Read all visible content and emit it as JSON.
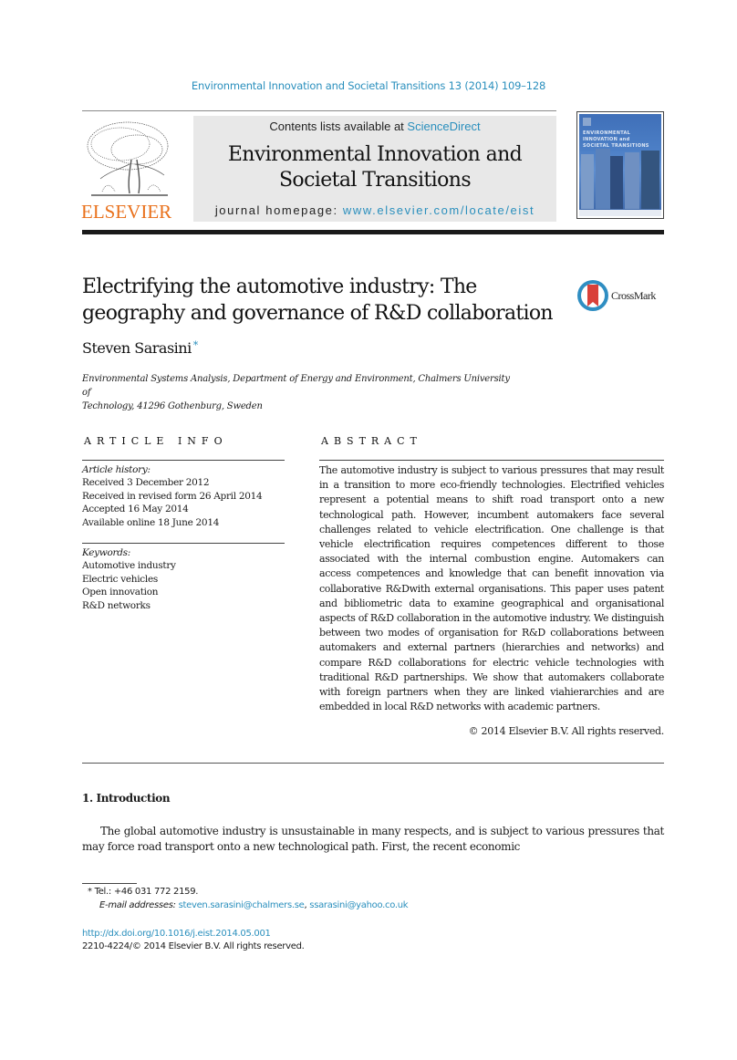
{
  "header": {
    "journal_ref": "Environmental Innovation and Societal Transitions 13 (2014) 109–128",
    "publisher_wordmark": "ELSEVIER",
    "contents_prefix": "Contents lists available at ",
    "contents_link": "ScienceDirect",
    "journal_title_line1": "Environmental Innovation and",
    "journal_title_line2": "Societal Transitions",
    "homepage_prefix": "journal homepage: ",
    "homepage_link": "www.elsevier.com/locate/eist",
    "cover": {
      "line1": "ENVIRONMENTAL",
      "line2": "INNOVATION and",
      "line3": "SOCIETAL TRANSITIONS"
    }
  },
  "article": {
    "title_line1": "Electrifying the automotive industry: The",
    "title_line2": "geography and governance of R&D collaboration",
    "crossmark_label": "CrossMark",
    "author": "Steven Sarasini",
    "author_mark": "*",
    "affiliation_line1": "Environmental Systems Analysis, Department of Energy and Environment, Chalmers University of",
    "affiliation_line2": "Technology, 41296 Gothenburg, Sweden"
  },
  "article_info": {
    "heading": "ARTICLE INFO",
    "history_label": "Article history:",
    "history": [
      "Received 3 December 2012",
      "Received in revised form 26 April 2014",
      "Accepted 16 May 2014",
      "Available online 18 June 2014"
    ],
    "keywords_label": "Keywords:",
    "keywords": [
      "Automotive industry",
      "Electric vehicles",
      "Open innovation",
      "R&D networks"
    ]
  },
  "abstract": {
    "heading": "ABSTRACT",
    "text": "The automotive industry is subject to various pressures that may result in a transition to more eco-friendly technologies. Electrified vehicles represent a potential means to shift road transport onto a new technological path. However, incumbent automakers face several challenges related to vehicle electrification. One challenge is that vehicle electrification requires competences different to those associated with the internal combustion engine. Automakers can access competences and knowledge that can benefit innovation via collaborative R&Dwith external organisations. This paper uses patent and bibliometric data to examine geographical and organisational aspects of R&D collaboration in the automotive industry. We distinguish between two modes of organisation for R&D collaborations between automakers and external partners (hierarchies and networks) and compare R&D collaborations for electric vehicle technologies with traditional R&D partnerships. We show that automakers collaborate with foreign partners when they are linked viahierarchies and are embedded in local R&D networks with academic partners.",
    "copyright": "© 2014 Elsevier B.V. All rights reserved."
  },
  "introduction": {
    "heading": "1.  Introduction",
    "text": "The global automotive industry is unsustainable in many respects, and is subject to various pressures that may force road transport onto a new technological path. First, the recent economic"
  },
  "footnotes": {
    "tel_mark": "*",
    "tel": " Tel.: +46 031 772 2159.",
    "email_label": "E-mail addresses: ",
    "email1": "steven.sarasini@chalmers.se",
    "email_sep": ", ",
    "email2": "ssarasini@yahoo.co.uk",
    "doi": "http://dx.doi.org/10.1016/j.eist.2014.05.001",
    "issn": "2210-4224/© 2014 Elsevier B.V. All rights reserved."
  },
  "colors": {
    "link": "#2a8fbd",
    "elsevier_orange": "#e9711c",
    "banner_gray": "#e8e8e8"
  }
}
